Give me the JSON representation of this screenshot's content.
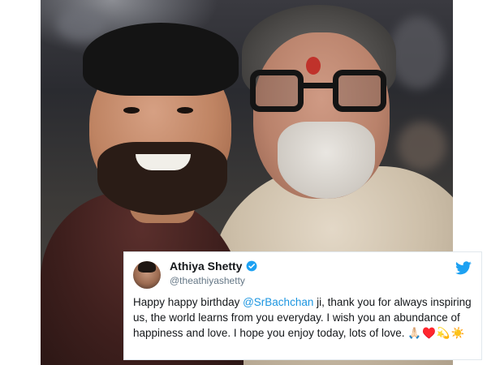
{
  "tweet": {
    "author_name": "Athiya Shetty",
    "handle": "@theathiyashetty",
    "text_before_mention": "Happy happy birthday ",
    "mention": "@SrBachchan",
    "text_after_mention": " ji, thank you for always inspiring us, the world learns from you everyday. I wish you an abundance of happiness and love. I hope you enjoy today, lots of love. ",
    "emojis": "🙏🏻♥️💫☀️",
    "verified_icon": "verified-badge-icon",
    "platform_icon": "twitter-bird-icon"
  },
  "colors": {
    "link_blue": "#1b95e0",
    "twitter_blue": "#1da1f2",
    "text_dark": "#14171a",
    "text_muted": "#657786"
  }
}
